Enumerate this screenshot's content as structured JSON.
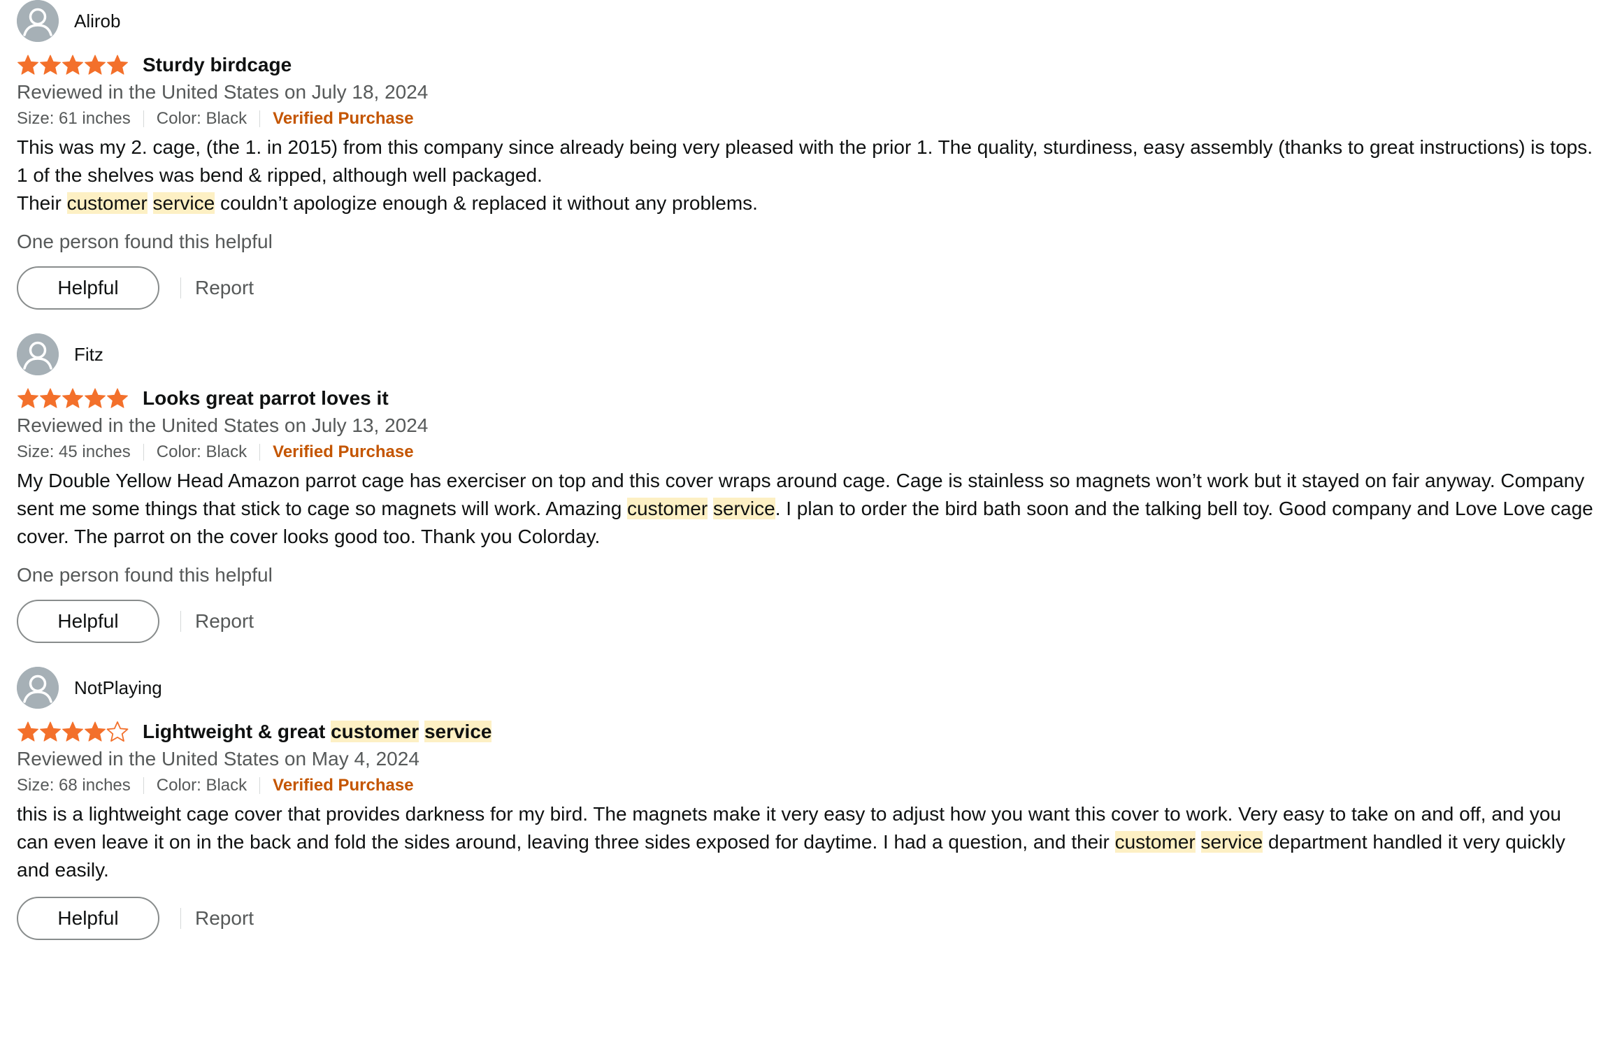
{
  "reviews": [
    {
      "profile_name": "Alirob",
      "rating": 5,
      "title": [
        "Sturdy birdcage"
      ],
      "date": "Reviewed in the United States on July 18, 2024",
      "size": "Size: 61 inches",
      "color": "Color: Black",
      "verified": "Verified Purchase",
      "body": [
        [
          "This was my 2. cage, (the 1. in 2015) from this company since already being very pleased with the prior 1. The quality, sturdiness, easy assembly (thanks to great instructions) is tops."
        ],
        [
          "1 of the shelves was bend & ripped, although well packaged."
        ],
        [
          "Their ",
          {
            "hl": "customer"
          },
          " ",
          {
            "hl": "service"
          },
          " couldn’t apologize enough & replaced it without any problems."
        ]
      ],
      "helpful_count": "One person found this helpful",
      "helpful_button": "Helpful",
      "report_link": "Report"
    },
    {
      "profile_name": "Fitz",
      "rating": 5,
      "title": [
        "Looks great parrot loves it"
      ],
      "date": "Reviewed in the United States on July 13, 2024",
      "size": "Size: 45 inches",
      "color": "Color: Black",
      "verified": "Verified Purchase",
      "body": [
        [
          "My Double Yellow Head Amazon parrot cage has exerciser on top and this cover wraps around cage. Cage is stainless so magnets won’t work but it stayed on fair anyway. Company sent me some things that stick to cage so magnets will work. Amazing ",
          {
            "hl": "customer"
          },
          " ",
          {
            "hl": "service"
          },
          ". I plan to order the bird bath soon and the talking bell toy. Good company and Love Love cage cover. The parrot on the cover looks good too. Thank you Colorday."
        ]
      ],
      "helpful_count": "One person found this helpful",
      "helpful_button": "Helpful",
      "report_link": "Report"
    },
    {
      "profile_name": "NotPlaying",
      "rating": 4,
      "title": [
        "Lightweight & great ",
        {
          "hl": "customer"
        },
        " ",
        {
          "hl": "service"
        }
      ],
      "date": "Reviewed in the United States on May 4, 2024",
      "size": "Size: 68 inches",
      "color": "Color: Black",
      "verified": "Verified Purchase",
      "body": [
        [
          "this is a lightweight cage cover that provides darkness for my bird. The magnets make it very easy to adjust how you want this cover to work. Very easy to take on and off, and you can even leave it on in the back and fold the sides around, leaving three sides exposed for daytime. I had a question, and their ",
          {
            "hl": "customer"
          },
          " ",
          {
            "hl": "service"
          },
          " department handled it very quickly and easily."
        ]
      ],
      "helpful_count": "",
      "helpful_button": "Helpful",
      "report_link": "Report"
    }
  ],
  "colors": {
    "star": "#f3702b",
    "verified": "#c45500",
    "highlight": "#fdf0c4",
    "muted_text": "#565959",
    "avatar": "#a6b0b6"
  },
  "icons": {
    "avatar": "person-silhouette-icon",
    "star_full": "star-filled-icon",
    "star_empty": "star-outline-icon"
  }
}
